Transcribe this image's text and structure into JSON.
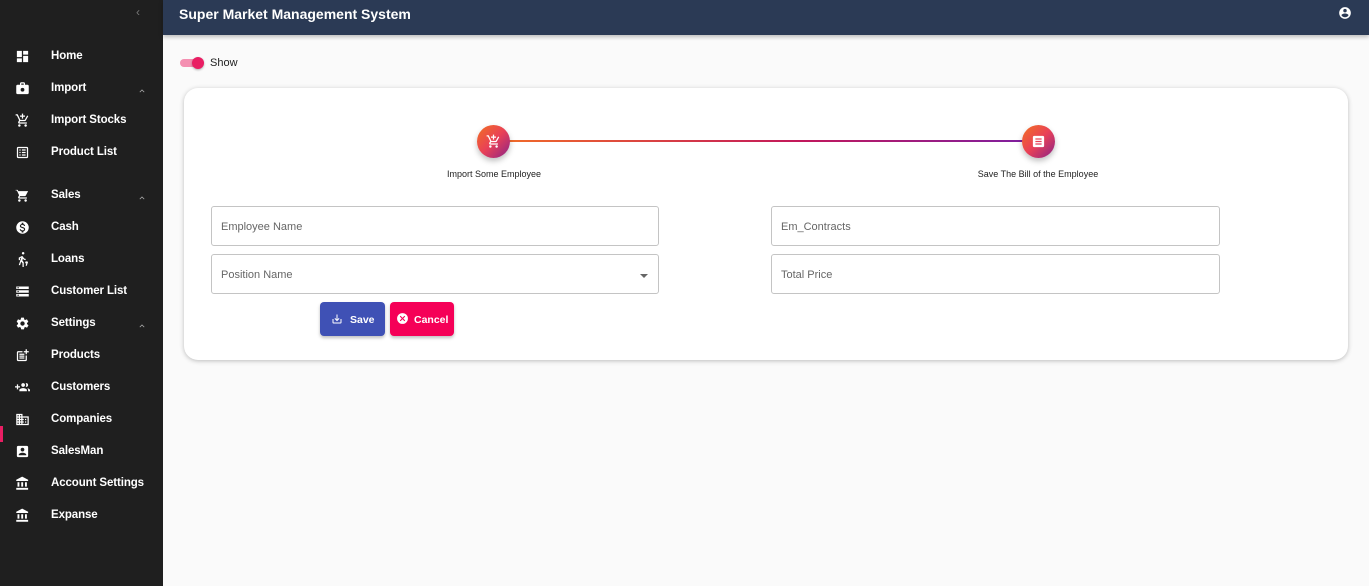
{
  "app": {
    "title": "Super Market Management System"
  },
  "sidebar": {
    "items": [
      {
        "label": "Home",
        "icon": "dashboard-icon"
      },
      {
        "label": "Import",
        "icon": "briefcase-icon",
        "expandable": true
      },
      {
        "label": "Import Stocks",
        "icon": "cart-add-icon"
      },
      {
        "label": "Product List",
        "icon": "list-icon"
      },
      {
        "label": "Sales",
        "icon": "cart-icon",
        "expandable": true
      },
      {
        "label": "Cash",
        "icon": "dollar-circle-icon"
      },
      {
        "label": "Loans",
        "icon": "person-cart-icon"
      },
      {
        "label": "Customer List",
        "icon": "storage-icon"
      },
      {
        "label": "Settings",
        "icon": "gear-icon",
        "expandable": true
      },
      {
        "label": "Products",
        "icon": "post-add-icon"
      },
      {
        "label": "Customers",
        "icon": "group-add-icon"
      },
      {
        "label": "Companies",
        "icon": "building-icon"
      },
      {
        "label": "SalesMan",
        "icon": "contact-card-icon"
      },
      {
        "label": "Account Settings",
        "icon": "bank-icon"
      },
      {
        "label": "Expanse",
        "icon": "bank-icon"
      }
    ]
  },
  "toggle": {
    "label": "Show",
    "checked": true
  },
  "stepper": {
    "steps": [
      {
        "label": "Import Some Employee",
        "icon": "cart-add-icon"
      },
      {
        "label": "Save The Bill of the Employee",
        "icon": "receipt-icon"
      }
    ]
  },
  "form": {
    "employee_name": {
      "placeholder": "Employee Name",
      "value": ""
    },
    "position_name": {
      "placeholder": "Position Name",
      "value": ""
    },
    "em_contracts": {
      "placeholder": "Em_Contracts",
      "value": ""
    },
    "total_price": {
      "placeholder": "Total Price",
      "value": ""
    }
  },
  "buttons": {
    "save": "Save",
    "cancel": "Cancel"
  },
  "colors": {
    "sidebar_bg": "#1f1f1f",
    "topbar_bg": "#2b3a55",
    "primary": "#3f51b5",
    "accent": "#f50057",
    "gradient_start": "#f27121",
    "gradient_end": "#8a2387"
  }
}
